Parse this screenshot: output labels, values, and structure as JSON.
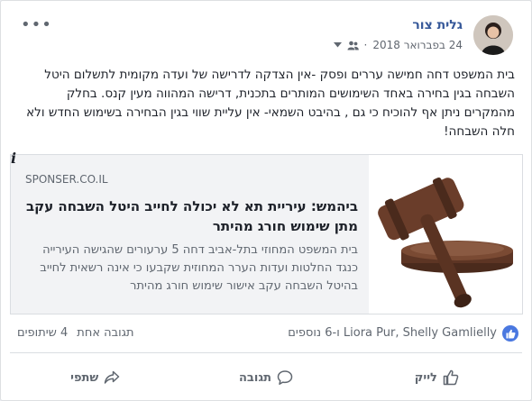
{
  "post": {
    "author": "גלית צור",
    "date": "24 בפברואר 2018",
    "text": "בית המשפט דחה חמישה עררים ופסק -אין הצדקה לדרישה של ועדה מקומית לתשלום היטל השבחה בגין בחירה באחד השימושים המותרים בתכנית, דרישה המהווה מעין קנס. בחלק מהמקרים ניתן אף להוכיח כי גם , בהיבט השמאי- אין עליית שווי בגין הבחירה בשימוש החדש ולא חלה השבחה!"
  },
  "link_preview": {
    "domain": "SPONSER.CO.IL",
    "title": "ביהמש: עיריית תא לא יכולה לחייב היטל השבחה עקב מתן שימוש חורג מהיתר",
    "description": "בית המשפט המחוזי בתל-אביב דחה 5 ערעורים שהגישה העירייה כנגד החלטות ועדות הערר המחוזית שקבעו כי אינה רשאית לחייב בהיטל השבחה עקב אישור שימוש חורג מהיתר"
  },
  "stats": {
    "reactors": "Liora Pur, Shelly Gamlielly ו-6 נוספים",
    "comments": "תגובה אחת",
    "shares": "4 שיתופים"
  },
  "actions": {
    "like": "לייק",
    "comment": "תגובה",
    "share": "שתפי"
  },
  "colors": {
    "author": "#365899",
    "like_badge": "#4a78e0"
  }
}
